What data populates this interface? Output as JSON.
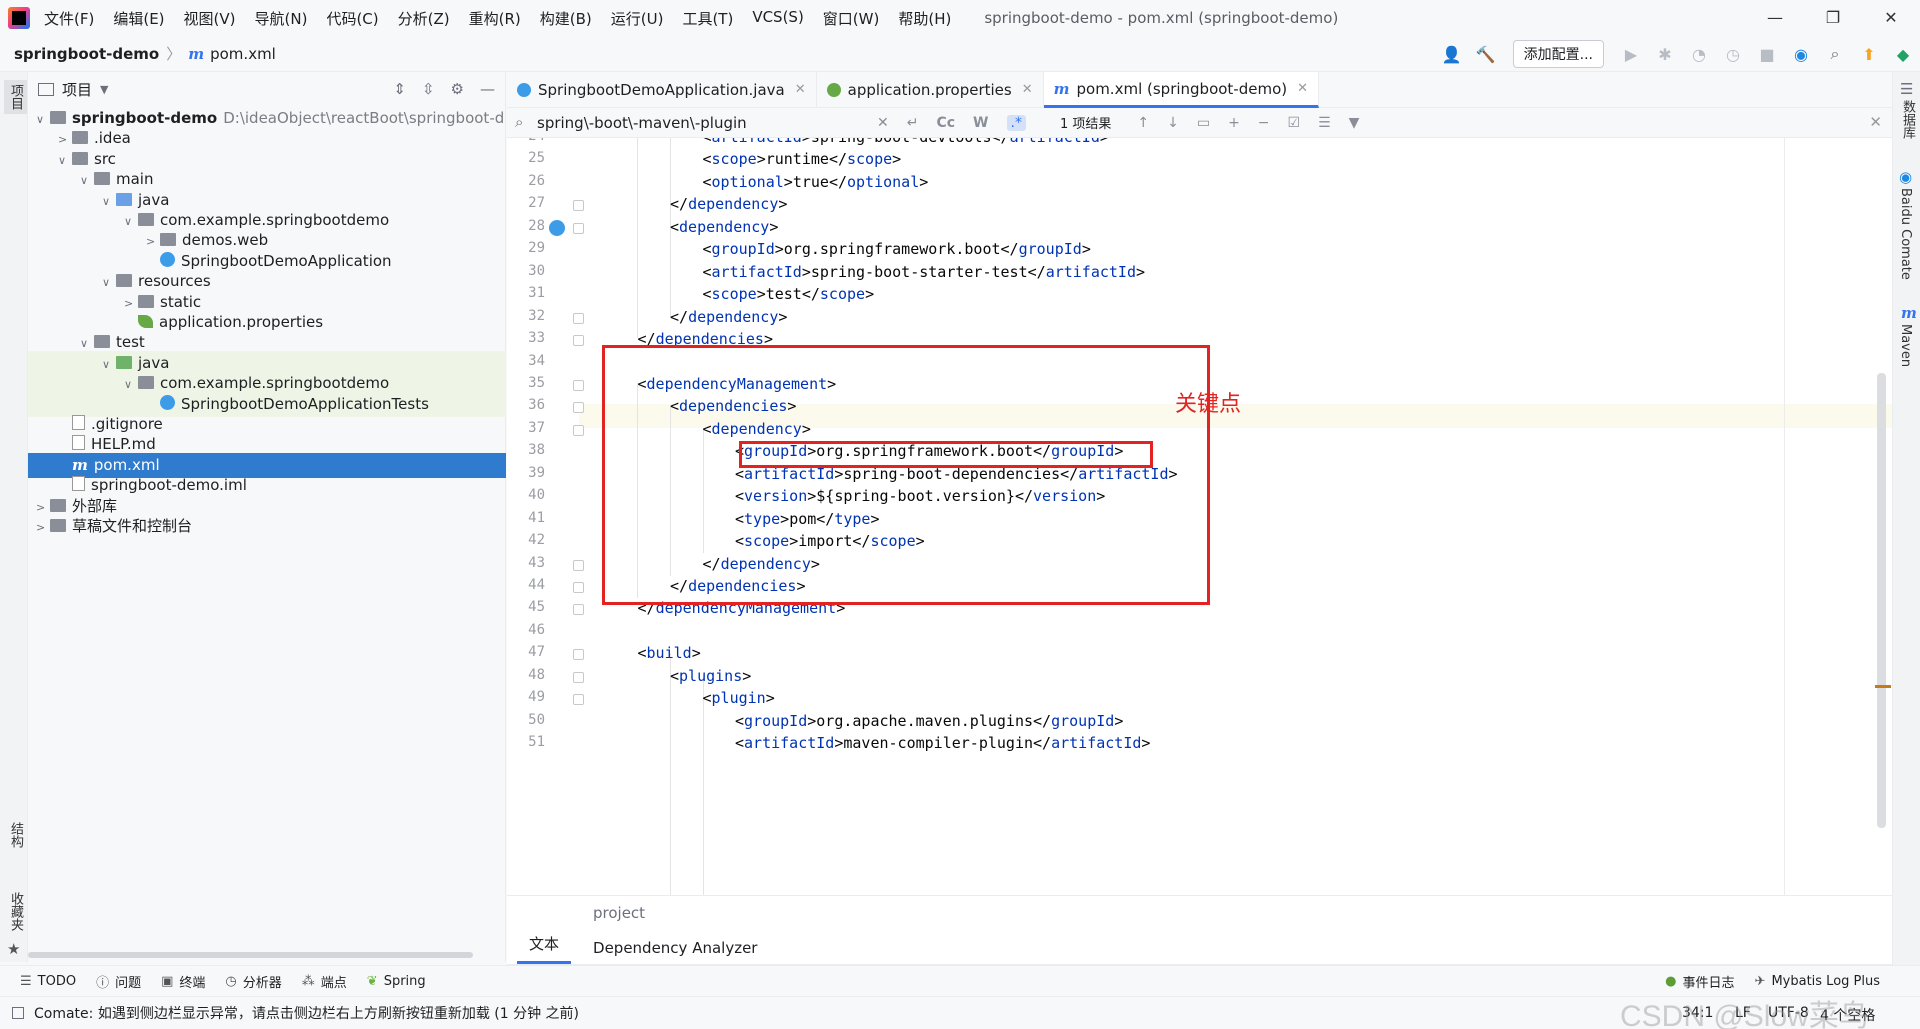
{
  "window": {
    "menu": [
      "文件(F)",
      "编辑(E)",
      "视图(V)",
      "导航(N)",
      "代码(C)",
      "分析(Z)",
      "重构(R)",
      "构建(B)",
      "运行(U)",
      "工具(T)",
      "VCS(S)",
      "窗口(W)",
      "帮助(H)"
    ],
    "title": "springboot-demo - pom.xml (springboot-demo)",
    "controls": [
      "—",
      "❐",
      "✕"
    ]
  },
  "navbar": {
    "project": "springboot-demo",
    "file": "pom.xml",
    "add_config": "添加配置..."
  },
  "left_stripe": {
    "project": "项目",
    "structure": "结构",
    "favorites": "收藏夹"
  },
  "right_stripe": {
    "database": "数据库",
    "comate": "Baidu Comate",
    "maven": "Maven"
  },
  "project_panel": {
    "title": "项目",
    "tree": [
      {
        "label": "springboot-demo",
        "extra": "D:\\ideaObject\\reactBoot\\springboot-d",
        "arrow": "∨",
        "icon": "folder",
        "depth": 0,
        "bold": true
      },
      {
        "label": ".idea",
        "arrow": ">",
        "icon": "folder",
        "depth": 1
      },
      {
        "label": "src",
        "arrow": "∨",
        "icon": "folder",
        "depth": 1
      },
      {
        "label": "main",
        "arrow": "∨",
        "icon": "folder",
        "depth": 2
      },
      {
        "label": "java",
        "arrow": "∨",
        "icon": "folder-blue",
        "depth": 3
      },
      {
        "label": "com.example.springbootdemo",
        "arrow": "∨",
        "icon": "folder",
        "depth": 4
      },
      {
        "label": "demos.web",
        "arrow": ">",
        "icon": "folder",
        "depth": 5
      },
      {
        "label": "SpringbootDemoApplication",
        "arrow": "",
        "icon": "class",
        "depth": 5
      },
      {
        "label": "resources",
        "arrow": "∨",
        "icon": "folder",
        "depth": 3
      },
      {
        "label": "static",
        "arrow": ">",
        "icon": "folder",
        "depth": 4
      },
      {
        "label": "application.properties",
        "arrow": "",
        "icon": "leaf",
        "depth": 4
      },
      {
        "label": "test",
        "arrow": "∨",
        "icon": "folder",
        "depth": 2
      },
      {
        "label": "java",
        "arrow": "∨",
        "icon": "folder-green",
        "depth": 3,
        "green": true
      },
      {
        "label": "com.example.springbootdemo",
        "arrow": "∨",
        "icon": "folder",
        "depth": 4,
        "green": true
      },
      {
        "label": "SpringbootDemoApplicationTests",
        "arrow": "",
        "icon": "class",
        "depth": 5,
        "green": true
      },
      {
        "label": ".gitignore",
        "arrow": "",
        "icon": "file",
        "depth": 1
      },
      {
        "label": "HELP.md",
        "arrow": "",
        "icon": "file",
        "depth": 1
      },
      {
        "label": "pom.xml",
        "arrow": "",
        "icon": "m",
        "depth": 1,
        "selected": true
      },
      {
        "label": "springboot-demo.iml",
        "arrow": "",
        "icon": "file",
        "depth": 1
      },
      {
        "label": "外部库",
        "arrow": ">",
        "icon": "folder",
        "depth": 0
      },
      {
        "label": "草稿文件和控制台",
        "arrow": ">",
        "icon": "folder",
        "depth": 0
      }
    ]
  },
  "editor_tabs": [
    {
      "label": "SpringbootDemoApplication.java",
      "color": "#3d9ce8"
    },
    {
      "label": "application.properties",
      "color": "#67a847"
    },
    {
      "label": "pom.xml (springboot-demo)",
      "color": "m",
      "active": true
    }
  ],
  "find_bar": {
    "query": "spring\\-boot\\-maven\\-plugin",
    "results": "1 项结果",
    "options": [
      "Cc",
      "W",
      ".*"
    ]
  },
  "editor": {
    "inspection": "1",
    "annotation": "关键点",
    "lines": [
      {
        "n": "24",
        "indent": 3,
        "text": "<artifactId>spring-boot-devtools</artifactId>"
      },
      {
        "n": "25",
        "indent": 3,
        "text": "<scope>runtime</scope>"
      },
      {
        "n": "26",
        "indent": 3,
        "text": "<optional>true</optional>"
      },
      {
        "n": "27",
        "indent": 2,
        "text": "</dependency>"
      },
      {
        "n": "28",
        "indent": 2,
        "text": "<dependency>"
      },
      {
        "n": "29",
        "indent": 3,
        "text": "<groupId>org.springframework.boot</groupId>"
      },
      {
        "n": "30",
        "indent": 3,
        "text": "<artifactId>spring-boot-starter-test</artifactId>"
      },
      {
        "n": "31",
        "indent": 3,
        "text": "<scope>test</scope>"
      },
      {
        "n": "32",
        "indent": 2,
        "text": "</dependency>"
      },
      {
        "n": "33",
        "indent": 1,
        "text": "</dependencies>"
      },
      {
        "n": "34",
        "indent": 0,
        "text": ""
      },
      {
        "n": "35",
        "indent": 1,
        "text": "<dependencyManagement>"
      },
      {
        "n": "36",
        "indent": 2,
        "text": "<dependencies>"
      },
      {
        "n": "37",
        "indent": 3,
        "text": "<dependency>"
      },
      {
        "n": "38",
        "indent": 4,
        "text": "<groupId>org.springframework.boot</groupId>"
      },
      {
        "n": "39",
        "indent": 4,
        "text": "<artifactId>spring-boot-dependencies</artifactId>"
      },
      {
        "n": "40",
        "indent": 4,
        "text": "<version>${spring-boot.version}</version>"
      },
      {
        "n": "41",
        "indent": 4,
        "text": "<type>pom</type>"
      },
      {
        "n": "42",
        "indent": 4,
        "text": "<scope>import</scope>"
      },
      {
        "n": "43",
        "indent": 3,
        "text": "</dependency>"
      },
      {
        "n": "44",
        "indent": 2,
        "text": "</dependencies>"
      },
      {
        "n": "45",
        "indent": 1,
        "text": "</dependencyManagement>"
      },
      {
        "n": "46",
        "indent": 0,
        "text": ""
      },
      {
        "n": "47",
        "indent": 1,
        "text": "<build>"
      },
      {
        "n": "48",
        "indent": 2,
        "text": "<plugins>"
      },
      {
        "n": "49",
        "indent": 3,
        "text": "<plugin>"
      },
      {
        "n": "50",
        "indent": 4,
        "text": "<groupId>org.apache.maven.plugins</groupId>"
      },
      {
        "n": "51",
        "indent": 4,
        "text": "<artifactId>maven-compiler-plugin</artifactId>"
      }
    ]
  },
  "breadcrumb": "project",
  "bottom_tabs": [
    "文本",
    "Dependency Analyzer"
  ],
  "tool_windows": [
    "TODO",
    "问题",
    "终端",
    "分析器",
    "端点",
    "Spring"
  ],
  "tool_windows_right": [
    "事件日志",
    "Mybatis Log Plus"
  ],
  "status": {
    "message": "Comate: 如遇到侧边栏显示异常，请点击侧边栏右上方刷新按钮重新加载 (1 分钟 之前)",
    "position": "34:1",
    "line_sep": "LF",
    "encoding": "UTF-8",
    "indent": "4 个空格",
    "watermark": "CSDN @Slow菜鸟"
  }
}
